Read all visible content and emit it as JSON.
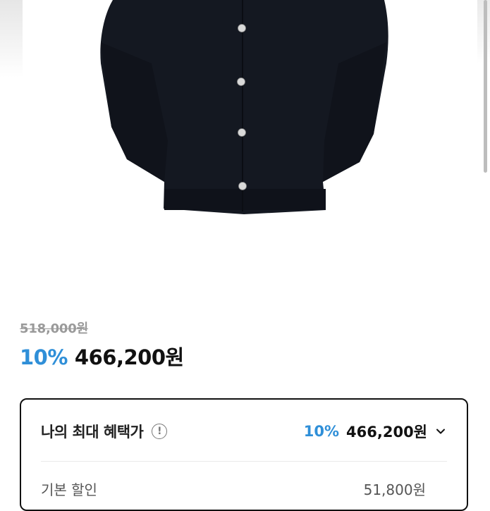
{
  "product": {
    "image_icon": "black-cardigan-photo"
  },
  "pricing": {
    "original_price": "518,000원",
    "discount_rate": "10%",
    "sale_price": "466,200원"
  },
  "benefit_card": {
    "title": "나의 최대 혜택가",
    "info_icon": "info-circle-icon",
    "discount_rate": "10%",
    "price": "466,200원",
    "toggle_icon": "chevron-down-icon",
    "rows": [
      {
        "label": "기본 할인",
        "value": "51,800원"
      }
    ]
  },
  "colors": {
    "accent_blue": "#2f8fd8",
    "garment": "#141821",
    "text": "#111111",
    "strike_grey": "#9a9a9a"
  }
}
